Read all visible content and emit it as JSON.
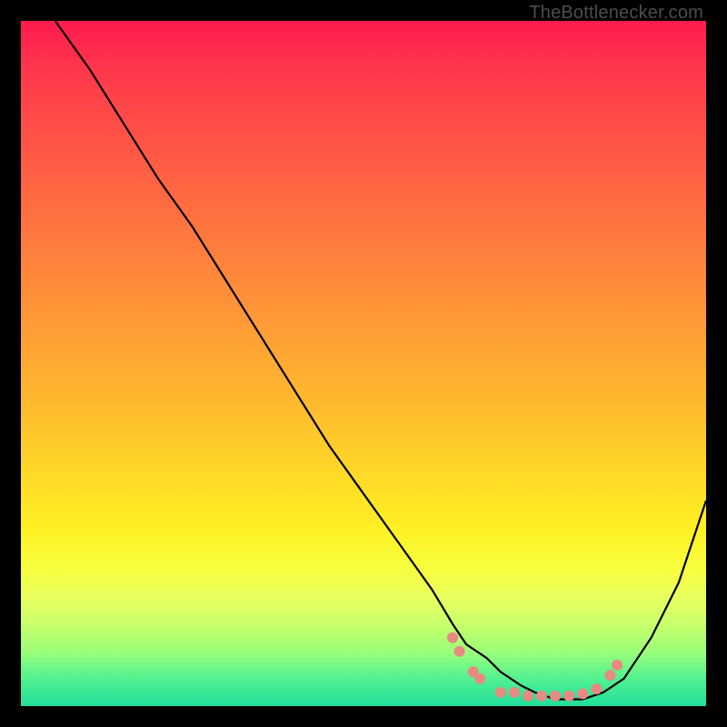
{
  "branding": {
    "text": "TheBottlenecker.com"
  },
  "chart_data": {
    "type": "line",
    "title": "",
    "xlabel": "",
    "ylabel": "",
    "xlim": [
      0,
      100
    ],
    "ylim": [
      0,
      100
    ],
    "grid": false,
    "background_gradient": {
      "direction": "vertical",
      "stops": [
        {
          "pos": 0.0,
          "color": "#ff1a4f"
        },
        {
          "pos": 0.5,
          "color": "#ffba2e"
        },
        {
          "pos": 0.78,
          "color": "#fff024"
        },
        {
          "pos": 0.92,
          "color": "#9cff78"
        },
        {
          "pos": 1.0,
          "color": "#1fdf9a"
        }
      ]
    },
    "series": [
      {
        "name": "bottleneck-curve",
        "color": "#000000",
        "x": [
          5,
          10,
          15,
          20,
          25,
          30,
          35,
          40,
          45,
          50,
          55,
          60,
          63,
          65,
          68,
          70,
          73,
          75,
          78,
          80,
          82,
          85,
          88,
          92,
          96,
          100
        ],
        "y": [
          100,
          93,
          85,
          77,
          70,
          62,
          54,
          46,
          38,
          31,
          24,
          17,
          12,
          9,
          7,
          5,
          3,
          2,
          1,
          1,
          1,
          2,
          4,
          10,
          18,
          30
        ]
      }
    ],
    "markers": {
      "name": "optimal-range-dots",
      "color": "#e88a82",
      "points": [
        {
          "x": 63,
          "y": 10
        },
        {
          "x": 64,
          "y": 8
        },
        {
          "x": 66,
          "y": 5
        },
        {
          "x": 67,
          "y": 4
        },
        {
          "x": 70,
          "y": 2
        },
        {
          "x": 72,
          "y": 2
        },
        {
          "x": 74,
          "y": 1.5
        },
        {
          "x": 76,
          "y": 1.5
        },
        {
          "x": 78,
          "y": 1.5
        },
        {
          "x": 80,
          "y": 1.5
        },
        {
          "x": 82,
          "y": 1.8
        },
        {
          "x": 84,
          "y": 2.5
        },
        {
          "x": 86,
          "y": 4.5
        },
        {
          "x": 87,
          "y": 6
        }
      ]
    }
  }
}
